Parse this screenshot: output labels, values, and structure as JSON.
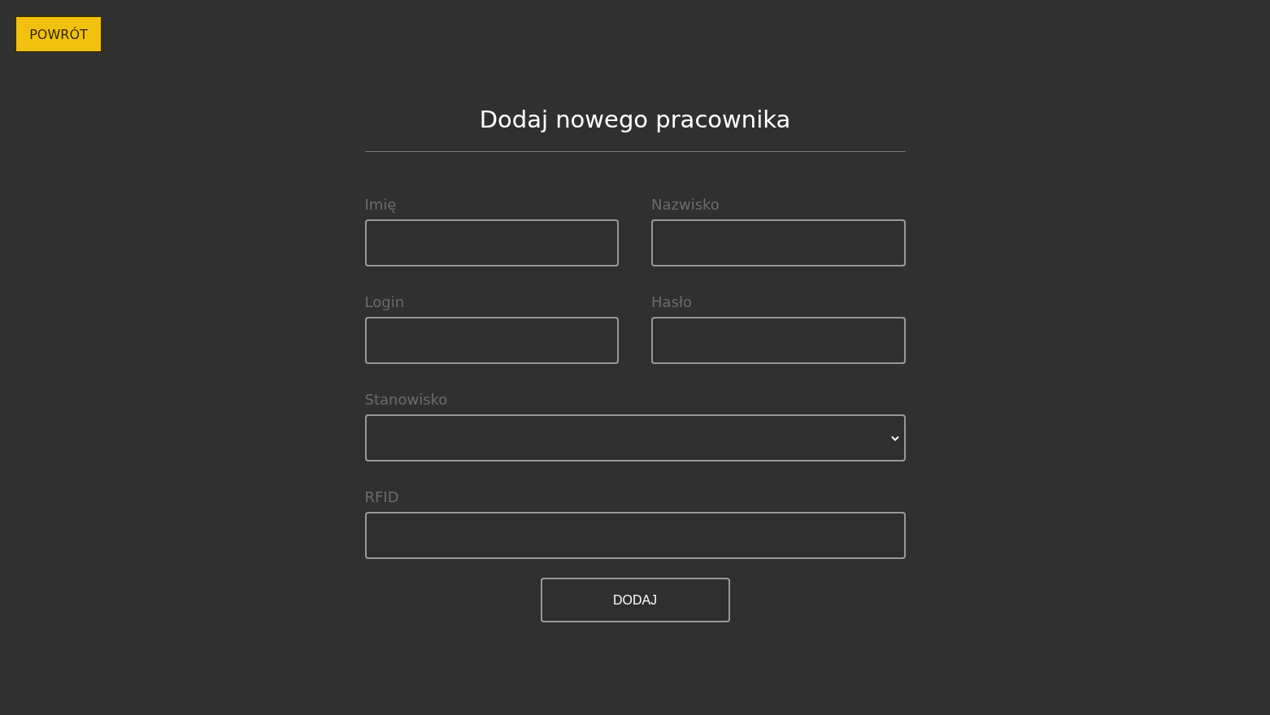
{
  "back_button": {
    "label": "POWRÓT"
  },
  "title": "Dodaj nowego pracownika",
  "fields": [
    {
      "label": "Imię",
      "kind": "text",
      "full_width": false
    },
    {
      "label": "Nazwisko",
      "kind": "text",
      "full_width": false
    },
    {
      "label": "Login",
      "kind": "text",
      "full_width": false
    },
    {
      "label": "Hasło",
      "kind": "password",
      "full_width": false
    },
    {
      "label": "Stanowisko",
      "kind": "select",
      "full_width": true
    },
    {
      "label": "RFID",
      "kind": "text",
      "full_width": true
    }
  ],
  "submit_button": {
    "label": "DODAJ"
  }
}
